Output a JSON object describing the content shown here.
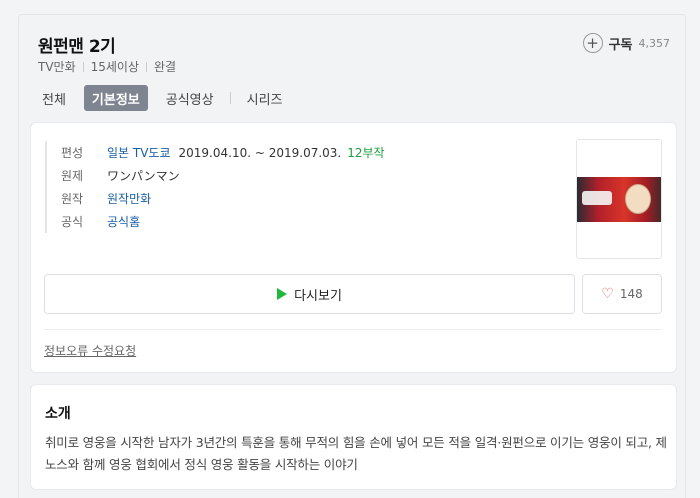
{
  "header": {
    "title": "원펀맨 2기",
    "subscribe_label": "구독",
    "subscribe_count": "4,357",
    "meta": [
      "TV만화",
      "15세이상",
      "완결"
    ]
  },
  "tabs": [
    "전체",
    "기본정보",
    "공식영상",
    "시리즈"
  ],
  "info": {
    "producer_label": "편성",
    "producer": "일본 TV도쿄",
    "period": "2019.04.10. ~ 2019.07.03.",
    "episodes": "12부작",
    "original_title_label": "원제",
    "original_title": "ワンパンマン",
    "origin_label": "원작",
    "origin": "원작만화",
    "official_label": "공식",
    "official": "공식홈"
  },
  "actions": {
    "watch_label": "다시보기",
    "like_count": "148",
    "report_label": "정보오류 수정요청"
  },
  "intro": {
    "title": "소개",
    "text": "취미로 영웅을 시작한 남자가 3년간의 특훈을 통해 무적의 힘을 손에 넣어 모든 적을 일격·원펀으로 이기는 영웅이 되고, 제노스와 함께 영웅 협회에서 정식 영웅 활동을 시작하는 이야기"
  },
  "colors": {
    "accent_link": "#1a5ea7",
    "episodes_green": "#1ca03d",
    "play_green": "#1fb93c",
    "heart_red": "#e8575b",
    "active_tab_bg": "#7e8590"
  },
  "icons": [
    "plus-circle-icon",
    "play-icon",
    "heart-icon"
  ]
}
